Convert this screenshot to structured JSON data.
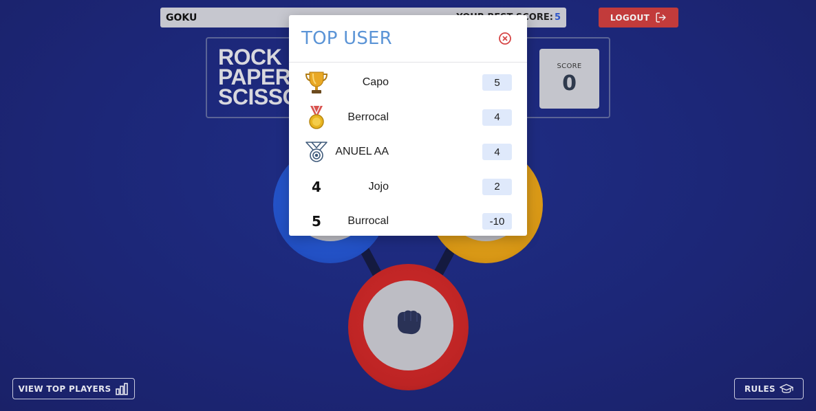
{
  "user": {
    "name": "GOKU"
  },
  "best_score": {
    "label": "YOUR BEST SCORE:",
    "value": "5"
  },
  "logout": {
    "label": "LOGOUT",
    "icon": "logout-icon"
  },
  "header": {
    "title_lines": [
      "ROCK",
      "PAPER",
      "SCISSORS"
    ],
    "score_label": "SCORE",
    "score_value": "0"
  },
  "game": {
    "tokens": [
      {
        "name": "paper",
        "color": "#2250c4"
      },
      {
        "name": "scissors",
        "color": "#d89715"
      },
      {
        "name": "rock",
        "color": "#bd2424",
        "icon": "fist-icon"
      }
    ]
  },
  "bottom": {
    "top_players_label": "VIEW TOP PLAYERS",
    "top_players_icon": "bar-chart-icon",
    "rules_label": "RULES",
    "rules_icon": "graduation-cap-icon"
  },
  "modal": {
    "title": "TOP USER",
    "close_icon": "close-circle-icon",
    "rows": [
      {
        "rank": "1",
        "icon": "trophy-icon",
        "name": "Capo",
        "score": "5"
      },
      {
        "rank": "2",
        "icon": "gold-medal-icon",
        "name": "Berrocal",
        "score": "4"
      },
      {
        "rank": "3",
        "icon": "silver-medal-icon",
        "name": "ANUEL AA",
        "score": "4"
      },
      {
        "rank": "4",
        "icon": "",
        "name": "Jojo",
        "score": "2"
      },
      {
        "rank": "5",
        "icon": "",
        "name": "Burrocal",
        "score": "-10"
      }
    ]
  },
  "colors": {
    "background": "#1c2676",
    "accent_blue": "#5b94d6",
    "logout_red": "#c23b3b",
    "score_badge": "#dfe9fb"
  }
}
